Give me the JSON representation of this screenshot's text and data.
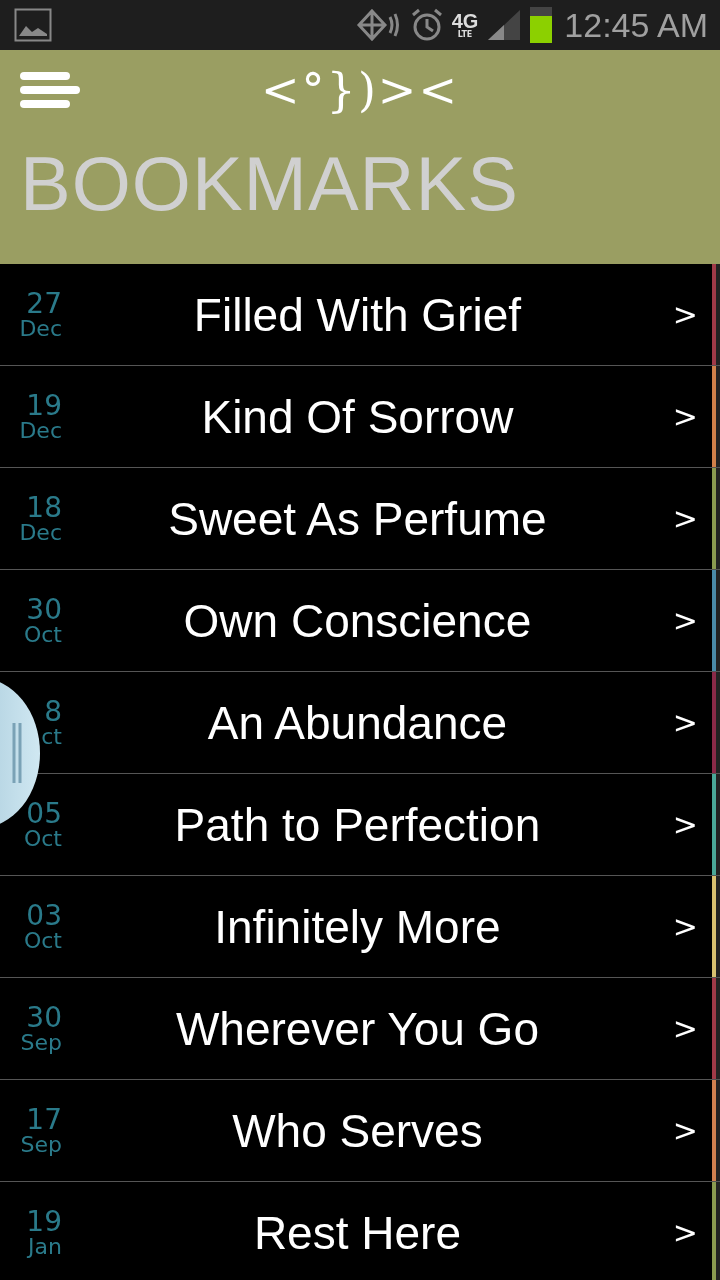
{
  "status_bar": {
    "network": "4G",
    "network_sub": "LTE",
    "time": "12:45 AM",
    "battery": {
      "level": 0.75
    }
  },
  "header": {
    "logo": "<°})><",
    "title": "BOOKMARKS"
  },
  "bookmarks": [
    {
      "day": "27",
      "month": "Dec",
      "title": "Filled With Grief",
      "chevron": ">",
      "color": "#a03a48"
    },
    {
      "day": "19",
      "month": "Dec",
      "title": "Kind Of Sorrow",
      "chevron": ">",
      "color": "#d0804a"
    },
    {
      "day": "18",
      "month": "Dec",
      "title": "Sweet As Perfume",
      "chevron": ">",
      "color": "#8a9a50"
    },
    {
      "day": "30",
      "month": "Oct",
      "title": "Own Conscience",
      "chevron": ">",
      "color": "#4a8aa8"
    },
    {
      "day": "8",
      "month": "ct",
      "title": "An Abundance",
      "chevron": ">",
      "color": "#8a2a48"
    },
    {
      "day": "05",
      "month": "Oct",
      "title": "Path to Perfection",
      "chevron": ">",
      "color": "#4aa898"
    },
    {
      "day": "03",
      "month": "Oct",
      "title": "Infinitely More",
      "chevron": ">",
      "color": "#d8c070"
    },
    {
      "day": "30",
      "month": "Sep",
      "title": "Wherever You Go",
      "chevron": ">",
      "color": "#a03a48"
    },
    {
      "day": "17",
      "month": "Sep",
      "title": "Who Serves",
      "chevron": ">",
      "color": "#d08050"
    },
    {
      "day": "19",
      "month": "Jan",
      "title": "Rest Here",
      "chevron": ">",
      "color": "#8a9a50"
    }
  ]
}
